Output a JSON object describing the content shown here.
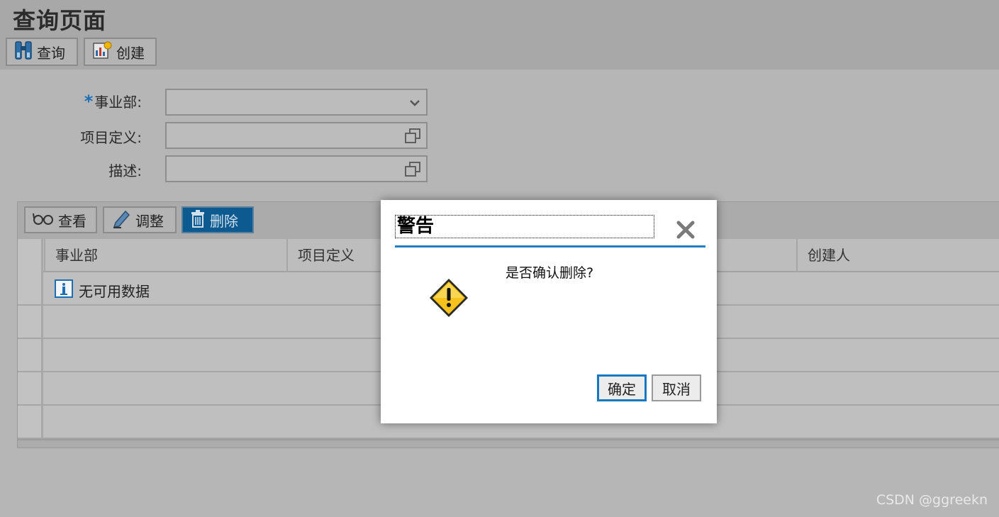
{
  "page": {
    "title": "查询页面"
  },
  "toolbar": {
    "query_label": "查询",
    "create_label": "创建"
  },
  "form": {
    "division": {
      "label": "事业部:",
      "required_mark": "*",
      "value": ""
    },
    "project_def": {
      "label": "项目定义:",
      "value": ""
    },
    "description": {
      "label": "描述:",
      "value": ""
    }
  },
  "grid": {
    "buttons": {
      "view": "查看",
      "adjust": "调整",
      "delete": "删除"
    },
    "columns": [
      "事业部",
      "项目定义",
      "",
      "创建人"
    ],
    "empty_text": "无可用数据"
  },
  "dialog": {
    "title": "警告",
    "message": "是否确认删除?",
    "ok_label": "确定",
    "cancel_label": "取消"
  },
  "watermark": "CSDN @ggreekn",
  "colors": {
    "accent": "#1f7fc4",
    "active_button": "#0c5a8f"
  }
}
